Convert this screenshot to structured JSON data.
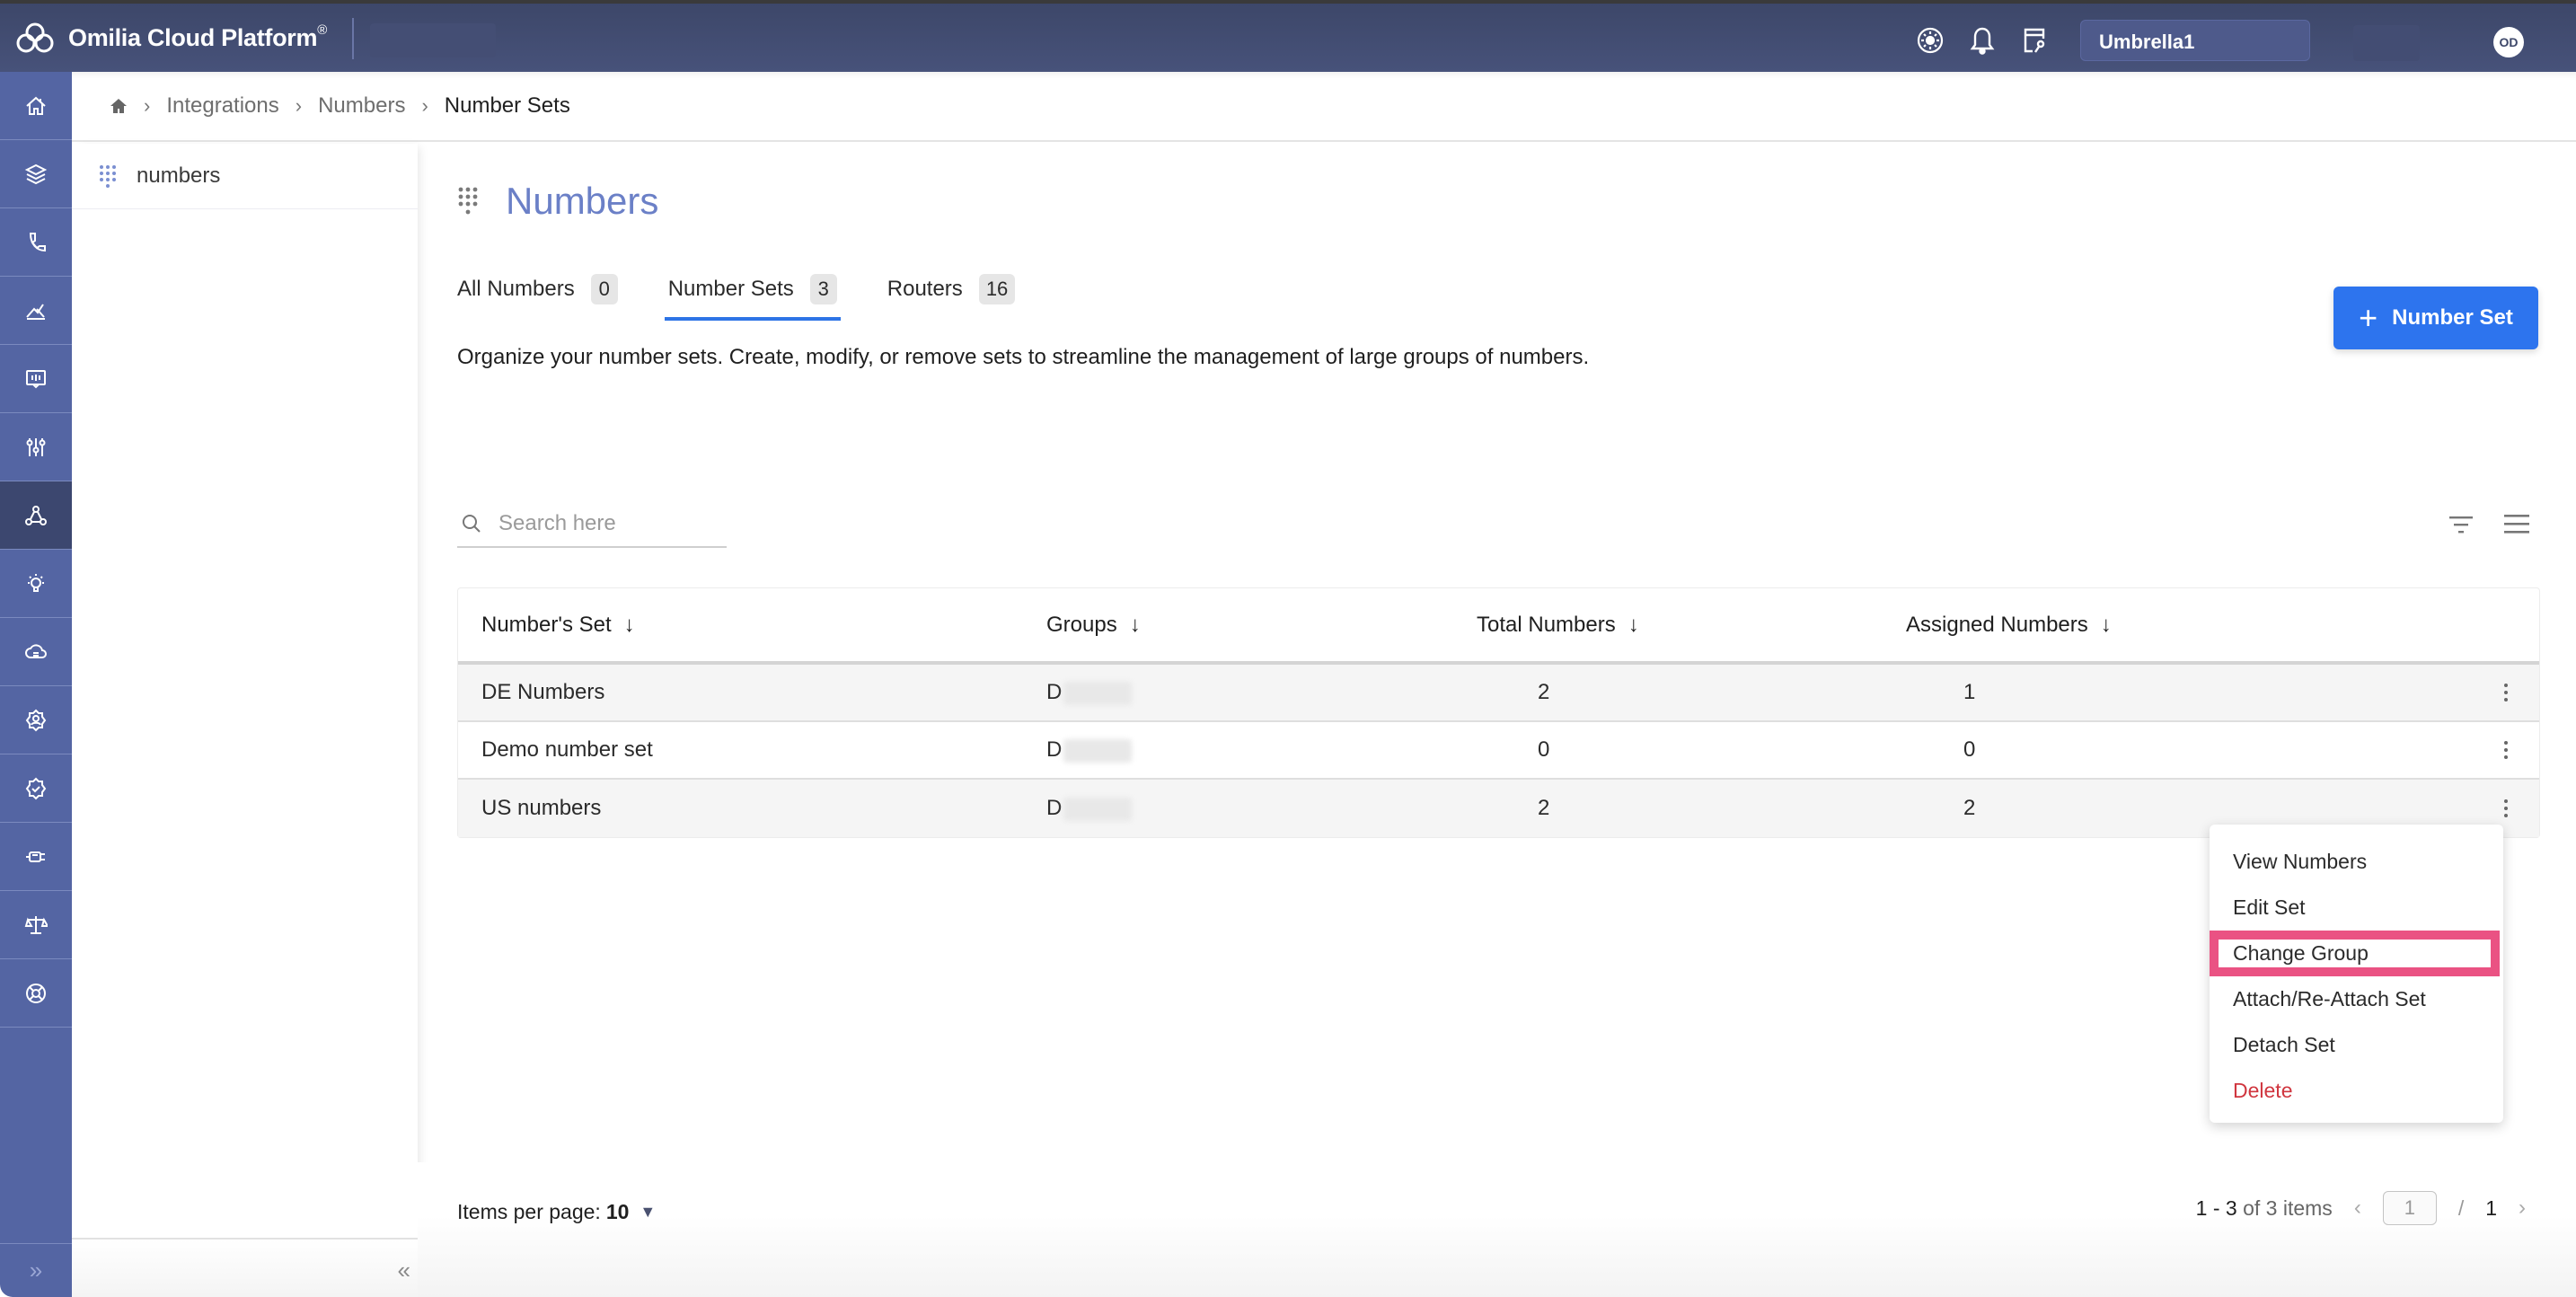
{
  "topbar": {
    "brand": "Omilia Cloud Platform",
    "brand_mark": "®",
    "tenant": "Umbrella1",
    "avatar_initials": "OD",
    "icons": [
      "theme-icon",
      "bell-icon",
      "api-key-icon"
    ]
  },
  "rail": {
    "items": [
      {
        "icon": "home-icon",
        "active": false
      },
      {
        "icon": "layers-icon",
        "active": false
      },
      {
        "icon": "phone-icon",
        "active": false
      },
      {
        "icon": "analytics-icon",
        "active": false
      },
      {
        "icon": "monitor-icon",
        "active": false
      },
      {
        "icon": "sliders-icon",
        "active": false
      },
      {
        "icon": "integrations-icon",
        "active": true
      },
      {
        "icon": "lightbulb-icon",
        "active": false
      },
      {
        "icon": "cloud-icon",
        "active": false
      },
      {
        "icon": "user-settings-icon",
        "active": false
      },
      {
        "icon": "verified-badge-icon",
        "active": false
      },
      {
        "icon": "usb-icon",
        "active": false
      },
      {
        "icon": "scale-icon",
        "active": false
      },
      {
        "icon": "lifebuoy-icon",
        "active": false
      }
    ],
    "expand_icon": "»"
  },
  "breadcrumb": {
    "items": [
      "Integrations",
      "Numbers"
    ],
    "current": "Number Sets"
  },
  "subnav": {
    "items": [
      {
        "label": "numbers",
        "icon": "dialpad-icon"
      }
    ],
    "collapse_icon": "«"
  },
  "page": {
    "title": "Numbers",
    "description": "Organize your number sets. Create, modify, or remove sets to streamline the management of large groups of numbers.",
    "add_button": "Number Set",
    "tabs": [
      {
        "label": "All Numbers",
        "count": "0",
        "active": false
      },
      {
        "label": "Number Sets",
        "count": "3",
        "active": true
      },
      {
        "label": "Routers",
        "count": "16",
        "active": false
      }
    ],
    "search_placeholder": "Search here"
  },
  "table": {
    "columns": [
      "Number's Set",
      "Groups",
      "Total Numbers",
      "Assigned Numbers"
    ],
    "rows": [
      {
        "name": "DE Numbers",
        "group": "D",
        "total": "2",
        "assigned": "1"
      },
      {
        "name": "Demo number set",
        "group": "D",
        "total": "0",
        "assigned": "0"
      },
      {
        "name": "US numbers",
        "group": "D",
        "total": "2",
        "assigned": "2"
      }
    ]
  },
  "context_menu": {
    "items": [
      {
        "label": "View Numbers",
        "danger": false,
        "highlighted": false
      },
      {
        "label": "Edit Set",
        "danger": false,
        "highlighted": false
      },
      {
        "label": "Change Group",
        "danger": false,
        "highlighted": true
      },
      {
        "label": "Attach/Re-Attach Set",
        "danger": false,
        "highlighted": false
      },
      {
        "label": "Detach Set",
        "danger": false,
        "highlighted": false
      },
      {
        "label": "Delete",
        "danger": true,
        "highlighted": false
      }
    ],
    "highlight_color": "#ea5283",
    "danger_color": "#d0363f"
  },
  "footer": {
    "items_per_page_label": "Items per page:",
    "items_per_page": "10",
    "range": "1 - 3",
    "range_suffix": "of 3 items",
    "current_page": "1",
    "total_pages": "1"
  },
  "colors": {
    "accent": "#2d74ee",
    "topbar": "#424c72",
    "rail": "#5465a3",
    "rail_active": "#3c476f",
    "title": "#6b80c7"
  }
}
